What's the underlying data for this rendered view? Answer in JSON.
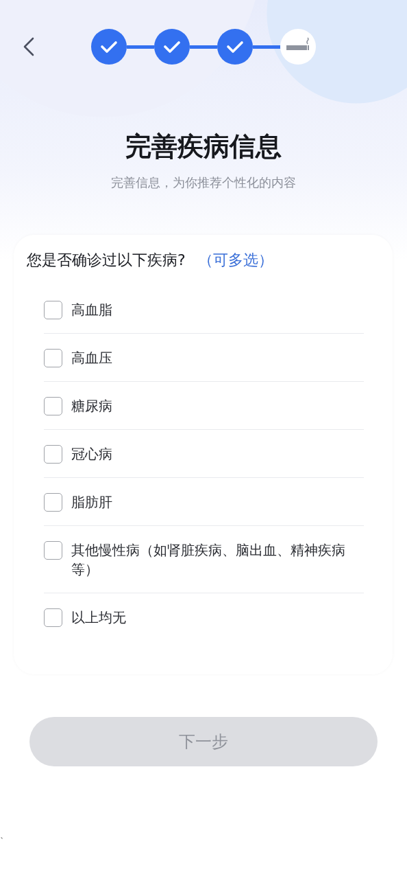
{
  "steps": [
    {
      "done": true
    },
    {
      "done": true
    },
    {
      "done": true
    },
    {
      "done": false
    }
  ],
  "title": "完善疾病信息",
  "subtitle": "完善信息，为你推荐个性化的内容",
  "question": {
    "text": "您是否确诊过以下疾病?",
    "hint": "（可多选）"
  },
  "options": [
    {
      "label": "高血脂",
      "checked": false
    },
    {
      "label": "高血压",
      "checked": false
    },
    {
      "label": "糖尿病",
      "checked": false
    },
    {
      "label": "冠心病",
      "checked": false
    },
    {
      "label": "脂肪肝",
      "checked": false
    },
    {
      "label": "其他慢性病（如肾脏疾病、脑出血、精神疾病等）",
      "checked": false
    },
    {
      "label": "以上均无",
      "checked": false
    }
  ],
  "next_button": {
    "label": "下一步",
    "disabled": true
  },
  "stray_mark": "、"
}
